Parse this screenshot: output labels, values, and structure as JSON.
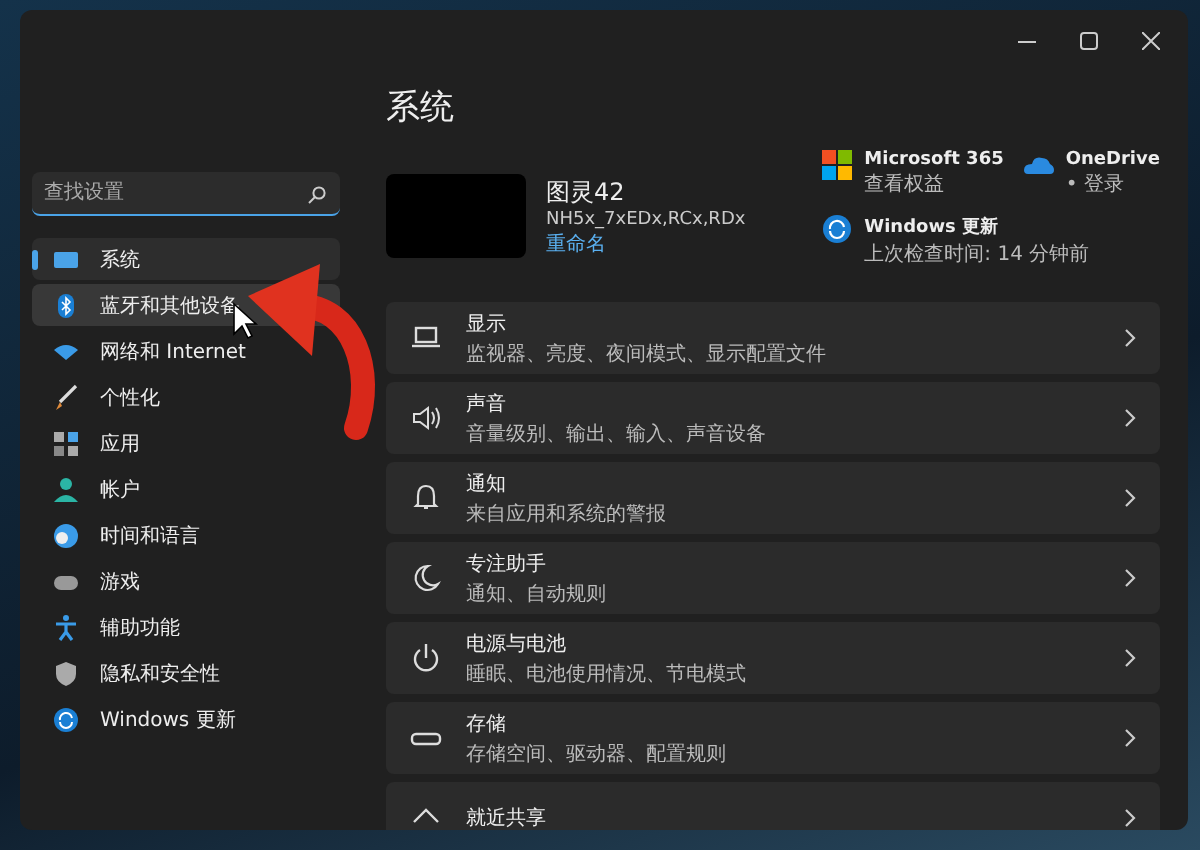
{
  "search": {
    "placeholder": "查找设置"
  },
  "sidebar": {
    "items": [
      {
        "label": "系统",
        "selected": true,
        "hovered": false
      },
      {
        "label": "蓝牙和其他设备",
        "selected": false,
        "hovered": true
      },
      {
        "label": "网络和 Internet",
        "selected": false,
        "hovered": false
      },
      {
        "label": "个性化",
        "selected": false,
        "hovered": false
      },
      {
        "label": "应用",
        "selected": false,
        "hovered": false
      },
      {
        "label": "帐户",
        "selected": false,
        "hovered": false
      },
      {
        "label": "时间和语言",
        "selected": false,
        "hovered": false
      },
      {
        "label": "游戏",
        "selected": false,
        "hovered": false
      },
      {
        "label": "辅助功能",
        "selected": false,
        "hovered": false
      },
      {
        "label": "隐私和安全性",
        "selected": false,
        "hovered": false
      },
      {
        "label": "Windows 更新",
        "selected": false,
        "hovered": false
      }
    ]
  },
  "main": {
    "title": "系统",
    "device": {
      "name": "图灵42",
      "model": "NH5x_7xEDx,RCx,RDx",
      "rename": "重命名"
    },
    "quick_links": [
      {
        "title": "Microsoft 365",
        "subtitle": "查看权益"
      },
      {
        "title": "OneDrive",
        "subtitle": "• 登录"
      },
      {
        "title": "Windows 更新",
        "subtitle": "上次检查时间: 14 分钟前"
      }
    ],
    "cards": [
      {
        "title": "显示",
        "subtitle": "监视器、亮度、夜间模式、显示配置文件"
      },
      {
        "title": "声音",
        "subtitle": "音量级别、输出、输入、声音设备"
      },
      {
        "title": "通知",
        "subtitle": "来自应用和系统的警报"
      },
      {
        "title": "专注助手",
        "subtitle": "通知、自动规则"
      },
      {
        "title": "电源与电池",
        "subtitle": "睡眠、电池使用情况、节电模式"
      },
      {
        "title": "存储",
        "subtitle": "存储空间、驱动器、配置规则"
      },
      {
        "title": "就近共享"
      }
    ]
  }
}
